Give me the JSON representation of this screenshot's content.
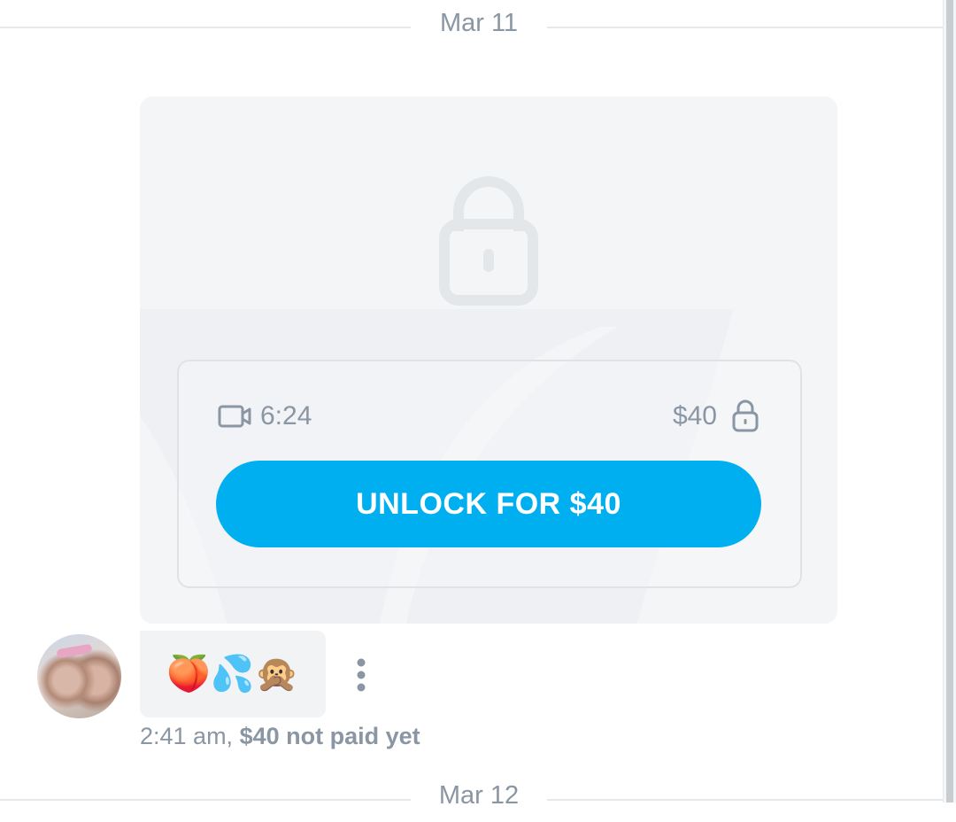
{
  "top_date_separator": "Mar 11",
  "bottom_date_separator": "Mar 12",
  "media": {
    "duration": "6:24",
    "price": "$40",
    "unlock_button_label": "UNLOCK FOR $40"
  },
  "message": {
    "text": "🍑💦🙊",
    "time": "2:41 am,",
    "payment_status": "$40 not paid yet"
  },
  "icons": {
    "big_lock": "lock-icon",
    "video": "video-camera-icon",
    "small_lock": "lock-icon",
    "more": "more-vertical-icon"
  },
  "colors": {
    "accent": "#00aff0",
    "muted_text": "#8a96a3",
    "card_bg": "#f4f5f7"
  }
}
